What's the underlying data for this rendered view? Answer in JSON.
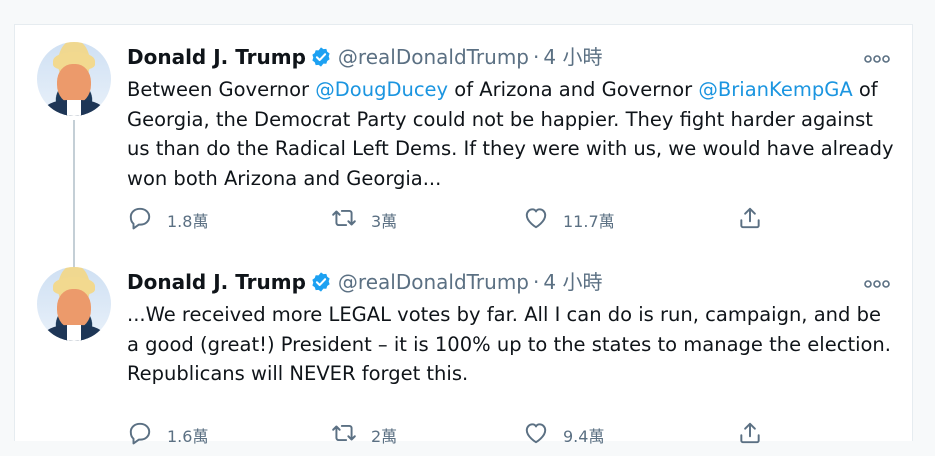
{
  "tweets": [
    {
      "author_name": "Donald J. Trump",
      "handle": "@realDonaldTrump",
      "separator": "·",
      "time": "4 小時",
      "text_parts": {
        "p1": "Between Governor ",
        "m1": "@DougDucey",
        "p2": " of Arizona and Governor ",
        "m2": "@BrianKempGA",
        "p3": " of Georgia, the Democrat Party could not be happier. They fight harder against us than do the Radical Left Dems. If they were with us, we would have already won both Arizona and Georgia..."
      },
      "replies": "1.8萬",
      "retweets": "3萬",
      "likes": "11.7萬"
    },
    {
      "author_name": "Donald J. Trump",
      "handle": "@realDonaldTrump",
      "separator": "·",
      "time": "4 小時",
      "text": "...We received more LEGAL votes by far. All I can do is run, campaign, and be a good (great!) President – it is 100% up to the states to manage the election. Republicans will NEVER forget this.",
      "replies": "1.6萬",
      "retweets": "2萬",
      "likes": "9.4萬"
    }
  ],
  "icons": {
    "verified": "verified-badge-icon",
    "more": "more-options-icon",
    "reply": "reply-icon",
    "retweet": "retweet-icon",
    "like": "heart-icon",
    "share": "share-icon"
  },
  "colors": {
    "link": "#1b95e0",
    "secondary_text": "#5b7083",
    "verified": "#1da1f2"
  }
}
